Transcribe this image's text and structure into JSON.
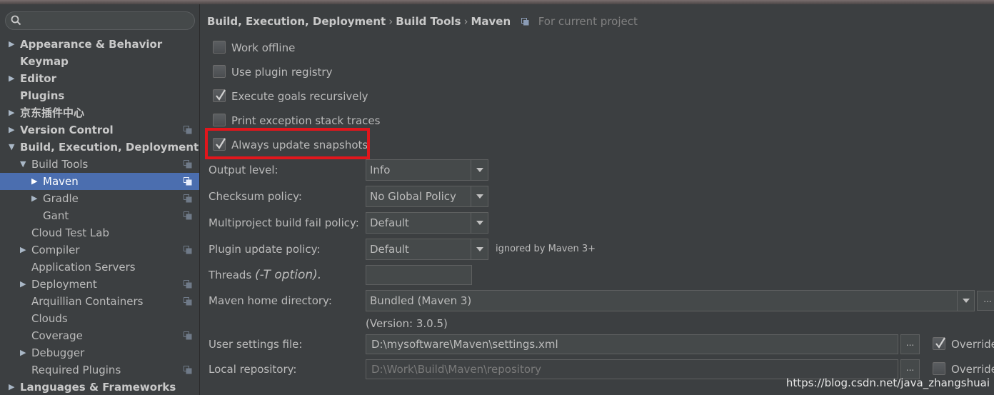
{
  "search": {
    "placeholder": ""
  },
  "sidebar": {
    "items": [
      {
        "label": "Appearance & Behavior",
        "level": 0,
        "arrow": "right",
        "bold": true,
        "copy": false
      },
      {
        "label": "Keymap",
        "level": 0,
        "arrow": "none",
        "bold": true,
        "copy": false
      },
      {
        "label": "Editor",
        "level": 0,
        "arrow": "right",
        "bold": true,
        "copy": false
      },
      {
        "label": "Plugins",
        "level": 0,
        "arrow": "none",
        "bold": true,
        "copy": false
      },
      {
        "label": "京东插件中心",
        "level": 0,
        "arrow": "right",
        "bold": true,
        "copy": false
      },
      {
        "label": "Version Control",
        "level": 0,
        "arrow": "right",
        "bold": true,
        "copy": true
      },
      {
        "label": "Build, Execution, Deployment",
        "level": 0,
        "arrow": "down",
        "bold": true,
        "copy": false
      },
      {
        "label": "Build Tools",
        "level": 1,
        "arrow": "down",
        "bold": false,
        "copy": true
      },
      {
        "label": "Maven",
        "level": 2,
        "arrow": "right",
        "bold": false,
        "copy": true,
        "selected": true
      },
      {
        "label": "Gradle",
        "level": 2,
        "arrow": "right",
        "bold": false,
        "copy": true
      },
      {
        "label": "Gant",
        "level": 2,
        "arrow": "none",
        "bold": false,
        "copy": true
      },
      {
        "label": "Cloud Test Lab",
        "level": 1,
        "arrow": "none",
        "bold": false,
        "copy": false
      },
      {
        "label": "Compiler",
        "level": 1,
        "arrow": "right",
        "bold": false,
        "copy": true
      },
      {
        "label": "Application Servers",
        "level": 1,
        "arrow": "none",
        "bold": false,
        "copy": false
      },
      {
        "label": "Deployment",
        "level": 1,
        "arrow": "right",
        "bold": false,
        "copy": true
      },
      {
        "label": "Arquillian Containers",
        "level": 1,
        "arrow": "none",
        "bold": false,
        "copy": true
      },
      {
        "label": "Clouds",
        "level": 1,
        "arrow": "none",
        "bold": false,
        "copy": false
      },
      {
        "label": "Coverage",
        "level": 1,
        "arrow": "none",
        "bold": false,
        "copy": true
      },
      {
        "label": "Debugger",
        "level": 1,
        "arrow": "right",
        "bold": false,
        "copy": false
      },
      {
        "label": "Required Plugins",
        "level": 1,
        "arrow": "none",
        "bold": false,
        "copy": true
      },
      {
        "label": "Languages & Frameworks",
        "level": 0,
        "arrow": "right",
        "bold": true,
        "copy": false
      }
    ]
  },
  "breadcrumb": {
    "parts": [
      "Build, Execution, Deployment",
      "Build Tools",
      "Maven"
    ],
    "separator": "›",
    "scope": "For current project"
  },
  "checkboxes": [
    {
      "label": "Work offline",
      "checked": false
    },
    {
      "label": "Use plugin registry",
      "checked": false
    },
    {
      "label": "Execute goals recursively",
      "checked": true
    },
    {
      "label": "Print exception stack traces",
      "checked": false
    },
    {
      "label": "Always update snapshots",
      "checked": true
    }
  ],
  "form": {
    "output_level": {
      "label": "Output level:",
      "value": "Info"
    },
    "checksum_policy": {
      "label": "Checksum policy:",
      "value": "No Global Policy"
    },
    "multiproject": {
      "label": "Multiproject build fail policy:",
      "value": "Default"
    },
    "plugin_update": {
      "label": "Plugin update policy:",
      "value": "Default",
      "note": "ignored by Maven 3+"
    },
    "threads": {
      "label": "Threads",
      "hint": "(-T option).",
      "value": ""
    },
    "maven_home": {
      "label": "Maven home directory:",
      "value": "Bundled (Maven 3)",
      "version": "(Version: 3.0.5)",
      "browse": "..."
    },
    "user_settings": {
      "label": "User settings file:",
      "value": "D:\\mysoftware\\Maven\\settings.xml",
      "browse": "...",
      "override": "Override",
      "override_checked": true
    },
    "local_repo": {
      "label": "Local repository:",
      "value": "D:\\Work\\Build\\Maven\\repository",
      "browse": "...",
      "override": "Override",
      "override_checked": false
    }
  },
  "watermark": "https://blog.csdn.net/java_zhangshuai",
  "colors": {
    "selection": "#4b6eaf",
    "highlight": "#e2161c",
    "background": "#3c3f41"
  }
}
